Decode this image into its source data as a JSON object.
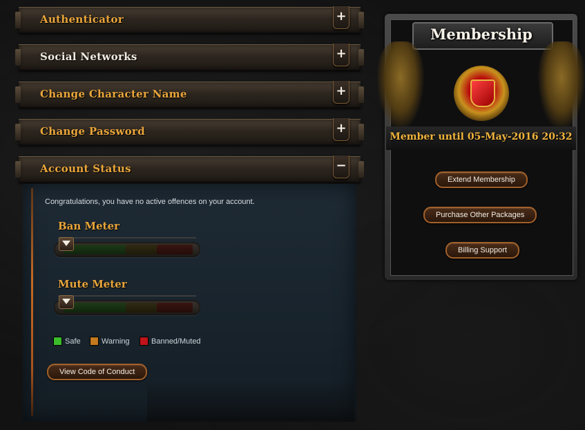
{
  "sections": [
    {
      "label": "Authenticator",
      "toggle": "+"
    },
    {
      "label": "Social Networks",
      "toggle": "+"
    },
    {
      "label": "Change Character Name",
      "toggle": "+"
    },
    {
      "label": "Change Password",
      "toggle": "+"
    },
    {
      "label": "Account Status",
      "toggle": "−"
    }
  ],
  "account_status": {
    "message": "Congratulations, you have no active offences on your account.",
    "ban_meter": {
      "title": "Ban Meter",
      "level": 0
    },
    "mute_meter": {
      "title": "Mute Meter",
      "level": 0
    },
    "legend": {
      "safe": "Safe",
      "warning": "Warning",
      "banned": "Banned/Muted"
    },
    "code_of_conduct_button": "View Code of Conduct"
  },
  "membership": {
    "title": "Membership",
    "status": "Member until 05-May-2016 20:32",
    "buttons": {
      "extend": "Extend Membership",
      "purchase": "Purchase Other Packages",
      "billing": "Billing Support"
    }
  },
  "colors": {
    "accent_gold": "#e9a53a",
    "safe": "#3bbd2a",
    "warning": "#c47a1e",
    "banned": "#c0141a"
  }
}
